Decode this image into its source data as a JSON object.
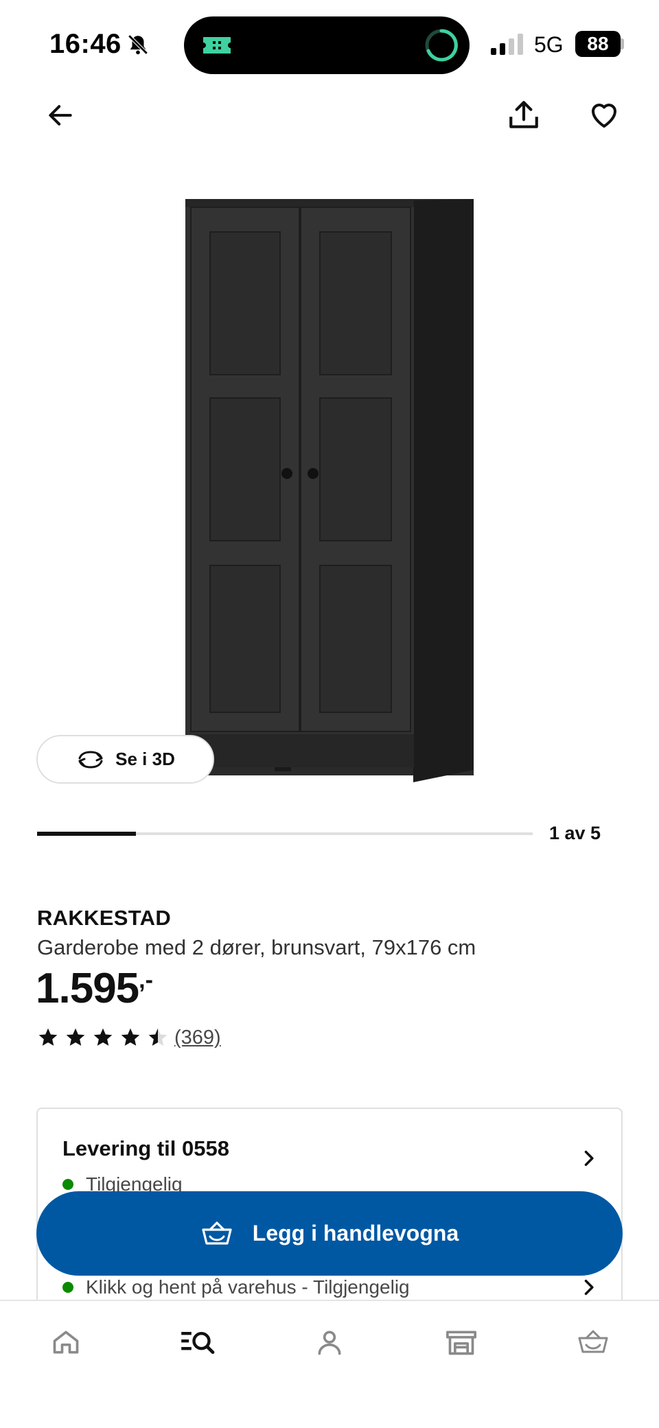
{
  "status_bar": {
    "time": "16:46",
    "network": "5G",
    "battery": "88",
    "icons": [
      "bell-muted-icon",
      "ticket-icon",
      "activity-ring-icon",
      "signal-bars-icon",
      "battery-icon"
    ]
  },
  "top_nav": {
    "icons": [
      "back-arrow-icon",
      "share-icon",
      "heart-icon"
    ]
  },
  "gallery": {
    "view_3d_label": "Se i 3D",
    "counter_label": "1 av 5",
    "current_image": 1,
    "total_images": 5
  },
  "product": {
    "name": "RAKKESTAD",
    "description": "Garderobe med 2 dører, brunsvart, 79x176 cm",
    "price": "1.595",
    "price_suffix": ",-",
    "rating": 4.5,
    "rating_max": 5,
    "review_count": "(369)"
  },
  "delivery": {
    "title": "Levering til 0558",
    "status": "Tilgjengelig",
    "pickup_status": "Klikk og hent på varehus - Tilgjengelig"
  },
  "cta": {
    "label": "Legg i handlevogna",
    "color": "#0058a3"
  },
  "bottom_nav": {
    "items": [
      "home-icon",
      "search-icon",
      "profile-icon",
      "store-icon",
      "cart-icon"
    ]
  },
  "colors": {
    "accent": "#0058a3",
    "available": "#0a8a00",
    "text": "#111111"
  }
}
